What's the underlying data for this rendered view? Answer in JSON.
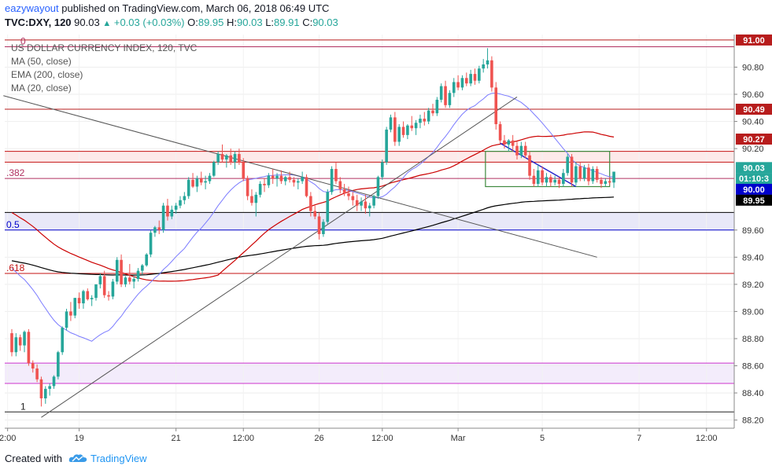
{
  "header": {
    "author": "eazywayout",
    "published_text": "published on TradingView.com, March 06, 2018 06:49 UTC",
    "symbol_interval": "TVC:DXY, 120",
    "last": "90.03",
    "change": "+0.03 (+0.03%)",
    "o_label": "O:",
    "o_value": "89.95",
    "h_label": "H:",
    "h_value": "90.03",
    "l_label": "L:",
    "l_value": "89.91",
    "c_label": "C:",
    "c_value": "90.03"
  },
  "legend": {
    "title": "US DOLLAR CURRENCY INDEX, 120, TVC",
    "items": [
      "MA (50, close)",
      "EMA (200, close)",
      "MA (20, close)"
    ]
  },
  "footer": {
    "created_with": "Created with",
    "brand": "TradingView"
  },
  "colors": {
    "up": "#26a69a",
    "down": "#ef5350",
    "ma50": "#cc0000",
    "ema200": "#000000",
    "ma20": "#7b7bff",
    "trend": "#555555",
    "fib_blue": "#0000cc",
    "fib_red": "#c41212",
    "purple": "#cc33cc",
    "box": "#3f8a3f",
    "blue_line": "#2222cc"
  },
  "chart_data": {
    "type": "candlestick",
    "y_range": [
      88.14,
      91.04
    ],
    "y_ticks": [
      "90.80",
      "90.60",
      "90.40",
      "90.20",
      "89.60",
      "89.40",
      "89.20",
      "89.00",
      "88.80",
      "88.60",
      "88.40",
      "88.20"
    ],
    "x_ticks": [
      "2:00",
      "19",
      "21",
      "12:00",
      "26",
      "12:00",
      "Mar",
      "5",
      "7",
      "12:00"
    ],
    "price_labels": [
      {
        "text": "91.00",
        "value": 91.0,
        "bg": "#b71c1c",
        "fg": "#ffffff"
      },
      {
        "text": "90.49",
        "value": 90.49,
        "bg": "#b71c1c",
        "fg": "#ffffff"
      },
      {
        "text": "90.27",
        "value": 90.27,
        "bg": "#b71c1c",
        "fg": "#ffffff"
      },
      {
        "text": "90.03",
        "value": 90.06,
        "bg": "#26a69a",
        "fg": "#ffffff"
      },
      {
        "text": "01:10:3",
        "value": 89.98,
        "bg": "#26a69a",
        "fg": "#ffffff"
      },
      {
        "text": "90.00",
        "value": 89.9,
        "bg": "#0000cc",
        "fg": "#ffffff"
      },
      {
        "text": "89.95",
        "value": 89.82,
        "bg": "#000000",
        "fg": "#ffffff"
      }
    ],
    "fib_levels": [
      {
        "label": "0",
        "value": 90.95
      },
      {
        "label": ".382",
        "value": 89.98
      },
      {
        "label": "0.5",
        "value": 89.6
      },
      {
        "label": ".618",
        "value": 89.28
      },
      {
        "label": "1",
        "value": 88.26
      }
    ],
    "horizontal_levels": [
      {
        "value": 91.0,
        "color": "#b71c1c"
      },
      {
        "value": 90.95,
        "color": "#222222"
      },
      {
        "value": 90.49,
        "color": "#b71c1c"
      },
      {
        "value": 90.18,
        "color": "#c41212"
      },
      {
        "value": 90.1,
        "color": "#c41212"
      },
      {
        "value": 89.73,
        "color": "#000000"
      },
      {
        "value": 88.62,
        "color": "#cc33cc"
      },
      {
        "value": 88.47,
        "color": "#cc33cc"
      }
    ],
    "bands": [
      {
        "from": 89.6,
        "to": 89.73,
        "color": "#e8e8f8"
      },
      {
        "from": 88.47,
        "to": 88.62,
        "color": "#f3ecfb"
      },
      {
        "from": 90.1,
        "to": 90.18,
        "color": "#fdeaea"
      }
    ],
    "trendlines": [
      {
        "from": [
          -2,
          90.59
        ],
        "to": [
          139,
          89.4
        ],
        "color": "#555555"
      },
      {
        "from": [
          7,
          88.22
        ],
        "to": [
          120,
          90.58
        ],
        "color": "#555555"
      },
      {
        "from": [
          116,
          90.24
        ],
        "to": [
          134,
          89.92
        ],
        "color": "#2222cc"
      }
    ],
    "box": {
      "i1": 112.5,
      "i2": 142,
      "top": 90.18,
      "bottom": 89.92
    },
    "candles": [
      [
        88.84,
        88.87,
        88.67,
        88.7
      ],
      [
        88.7,
        88.84,
        88.67,
        88.81
      ],
      [
        88.81,
        88.83,
        88.71,
        88.75
      ],
      [
        88.75,
        88.86,
        88.7,
        88.85
      ],
      [
        88.85,
        88.87,
        88.6,
        88.62
      ],
      [
        88.62,
        88.64,
        88.55,
        88.58
      ],
      [
        88.58,
        88.61,
        88.48,
        88.5
      ],
      [
        88.5,
        88.52,
        88.3,
        88.36
      ],
      [
        88.36,
        88.45,
        88.32,
        88.43
      ],
      [
        88.43,
        88.47,
        88.38,
        88.45
      ],
      [
        88.45,
        88.53,
        88.43,
        88.52
      ],
      [
        88.52,
        88.71,
        88.5,
        88.7
      ],
      [
        88.7,
        88.89,
        88.68,
        88.88
      ],
      [
        88.88,
        89.02,
        88.86,
        89.0
      ],
      [
        89.0,
        89.07,
        88.93,
        88.97
      ],
      [
        88.97,
        89.1,
        88.95,
        89.1
      ],
      [
        89.1,
        89.14,
        89.02,
        89.06
      ],
      [
        89.06,
        89.16,
        89.02,
        89.15
      ],
      [
        89.15,
        89.17,
        89.08,
        89.09
      ],
      [
        89.09,
        89.12,
        89.04,
        89.1
      ],
      [
        89.1,
        89.2,
        89.08,
        89.2
      ],
      [
        89.2,
        89.28,
        89.17,
        89.26
      ],
      [
        89.26,
        89.3,
        89.1,
        89.12
      ],
      [
        89.12,
        89.15,
        89.08,
        89.11
      ],
      [
        89.11,
        89.24,
        89.09,
        89.22
      ],
      [
        89.22,
        89.4,
        89.2,
        89.38
      ],
      [
        89.38,
        89.42,
        89.18,
        89.2
      ],
      [
        89.2,
        89.26,
        89.18,
        89.25
      ],
      [
        89.25,
        89.35,
        89.2,
        89.22
      ],
      [
        89.22,
        89.26,
        89.17,
        89.24
      ],
      [
        89.24,
        89.32,
        89.22,
        89.3
      ],
      [
        89.3,
        89.35,
        89.27,
        89.34
      ],
      [
        89.34,
        89.43,
        89.33,
        89.42
      ],
      [
        89.42,
        89.6,
        89.4,
        89.58
      ],
      [
        89.58,
        89.63,
        89.55,
        89.62
      ],
      [
        89.62,
        89.67,
        89.57,
        89.6
      ],
      [
        89.6,
        89.8,
        89.58,
        89.78
      ],
      [
        89.78,
        89.83,
        89.67,
        89.7
      ],
      [
        89.7,
        89.78,
        89.68,
        89.75
      ],
      [
        89.75,
        89.8,
        89.72,
        89.78
      ],
      [
        89.78,
        89.85,
        89.76,
        89.82
      ],
      [
        89.82,
        89.88,
        89.79,
        89.85
      ],
      [
        89.85,
        89.99,
        89.83,
        89.97
      ],
      [
        89.97,
        90.02,
        89.91,
        89.92
      ],
      [
        89.92,
        90.0,
        89.88,
        89.98
      ],
      [
        89.98,
        90.03,
        89.93,
        89.95
      ],
      [
        89.95,
        90.0,
        89.9,
        89.96
      ],
      [
        89.96,
        90.02,
        89.94,
        90.0
      ],
      [
        90.0,
        90.11,
        89.99,
        90.1
      ],
      [
        90.1,
        90.18,
        90.08,
        90.16
      ],
      [
        90.16,
        90.23,
        90.1,
        90.12
      ],
      [
        90.12,
        90.16,
        90.06,
        90.15
      ],
      [
        90.15,
        90.2,
        90.08,
        90.1
      ],
      [
        90.1,
        90.18,
        90.05,
        90.16
      ],
      [
        90.16,
        90.2,
        90.08,
        90.1
      ],
      [
        90.1,
        90.13,
        89.96,
        89.98
      ],
      [
        89.98,
        90.0,
        89.82,
        89.85
      ],
      [
        89.85,
        89.9,
        89.78,
        89.8
      ],
      [
        89.8,
        89.88,
        89.7,
        89.86
      ],
      [
        89.86,
        89.96,
        89.84,
        89.94
      ],
      [
        89.94,
        89.98,
        89.88,
        89.93
      ],
      [
        89.93,
        90.02,
        89.91,
        90.0
      ],
      [
        90.0,
        90.05,
        89.94,
        89.98
      ],
      [
        89.98,
        90.02,
        89.92,
        90.0
      ],
      [
        90.0,
        90.04,
        89.94,
        89.96
      ],
      [
        89.96,
        90.0,
        89.93,
        89.99
      ],
      [
        89.99,
        90.03,
        89.95,
        89.97
      ],
      [
        89.97,
        89.99,
        89.92,
        89.95
      ],
      [
        89.95,
        89.98,
        89.9,
        89.96
      ],
      [
        89.96,
        90.03,
        89.94,
        89.99
      ],
      [
        89.99,
        90.01,
        89.84,
        89.85
      ],
      [
        89.85,
        89.88,
        89.7,
        89.74
      ],
      [
        89.74,
        89.78,
        89.68,
        89.7
      ],
      [
        89.7,
        89.73,
        89.53,
        89.57
      ],
      [
        89.57,
        89.68,
        89.55,
        89.66
      ],
      [
        89.66,
        89.9,
        89.64,
        89.88
      ],
      [
        89.88,
        90.07,
        89.86,
        90.05
      ],
      [
        90.05,
        90.1,
        89.94,
        89.96
      ],
      [
        89.96,
        89.99,
        89.87,
        89.9
      ],
      [
        89.9,
        89.94,
        89.85,
        89.87
      ],
      [
        89.87,
        89.92,
        89.82,
        89.85
      ],
      [
        89.85,
        89.88,
        89.78,
        89.82
      ],
      [
        89.82,
        89.86,
        89.74,
        89.78
      ],
      [
        89.78,
        89.84,
        89.74,
        89.81
      ],
      [
        89.81,
        89.86,
        89.72,
        89.76
      ],
      [
        89.76,
        89.8,
        89.7,
        89.78
      ],
      [
        89.78,
        89.86,
        89.76,
        89.85
      ],
      [
        89.85,
        90.0,
        89.83,
        89.99
      ],
      [
        89.99,
        90.12,
        89.97,
        90.1
      ],
      [
        90.1,
        90.36,
        90.08,
        90.34
      ],
      [
        90.34,
        90.45,
        90.32,
        90.43
      ],
      [
        90.43,
        90.47,
        90.22,
        90.25
      ],
      [
        90.25,
        90.38,
        90.22,
        90.36
      ],
      [
        90.36,
        90.4,
        90.28,
        90.3
      ],
      [
        90.3,
        90.38,
        90.27,
        90.37
      ],
      [
        90.37,
        90.44,
        90.33,
        90.35
      ],
      [
        90.35,
        90.41,
        90.3,
        90.39
      ],
      [
        90.39,
        90.45,
        90.35,
        90.42
      ],
      [
        90.42,
        90.47,
        90.37,
        90.4
      ],
      [
        90.4,
        90.5,
        90.38,
        90.48
      ],
      [
        90.48,
        90.53,
        90.44,
        90.46
      ],
      [
        90.46,
        90.58,
        90.44,
        90.56
      ],
      [
        90.56,
        90.68,
        90.54,
        90.66
      ],
      [
        90.66,
        90.7,
        90.5,
        90.52
      ],
      [
        90.52,
        90.63,
        90.5,
        90.61
      ],
      [
        90.61,
        90.72,
        90.58,
        90.69
      ],
      [
        90.69,
        90.74,
        90.63,
        90.65
      ],
      [
        90.65,
        90.74,
        90.63,
        90.72
      ],
      [
        90.72,
        90.76,
        90.66,
        90.68
      ],
      [
        90.68,
        90.78,
        90.66,
        90.75
      ],
      [
        90.75,
        90.79,
        90.67,
        90.7
      ],
      [
        90.7,
        90.81,
        90.68,
        90.79
      ],
      [
        90.79,
        90.86,
        90.76,
        90.82
      ],
      [
        90.82,
        90.94,
        90.79,
        90.85
      ],
      [
        90.85,
        90.88,
        90.62,
        90.65
      ],
      [
        90.65,
        90.69,
        90.34,
        90.38
      ],
      [
        90.38,
        90.4,
        90.24,
        90.26
      ],
      [
        90.26,
        90.3,
        90.2,
        90.23
      ],
      [
        90.23,
        90.27,
        90.18,
        90.26
      ],
      [
        90.26,
        90.3,
        90.18,
        90.22
      ],
      [
        90.22,
        90.25,
        90.12,
        90.15
      ],
      [
        90.15,
        90.25,
        90.13,
        90.22
      ],
      [
        90.22,
        90.25,
        90.13,
        90.15
      ],
      [
        90.15,
        90.18,
        89.97,
        90.0
      ],
      [
        90.0,
        90.05,
        89.92,
        89.94
      ],
      [
        89.94,
        90.08,
        89.92,
        90.04
      ],
      [
        90.04,
        90.07,
        89.93,
        89.95
      ],
      [
        89.95,
        90.02,
        89.92,
        89.99
      ],
      [
        89.99,
        90.01,
        89.92,
        89.95
      ],
      [
        89.95,
        90.0,
        89.93,
        89.97
      ],
      [
        89.97,
        89.99,
        89.91,
        89.94
      ],
      [
        89.94,
        90.05,
        89.92,
        90.02
      ],
      [
        90.02,
        90.16,
        90.0,
        90.14
      ],
      [
        90.14,
        90.16,
        89.92,
        89.95
      ],
      [
        89.95,
        90.1,
        89.93,
        90.07
      ],
      [
        90.07,
        90.1,
        89.96,
        89.98
      ],
      [
        89.98,
        90.08,
        89.96,
        90.06
      ],
      [
        90.06,
        90.09,
        89.93,
        89.96
      ],
      [
        89.96,
        90.07,
        89.94,
        90.05
      ],
      [
        90.05,
        90.07,
        89.95,
        89.97
      ],
      [
        89.97,
        89.99,
        89.91,
        89.94
      ],
      [
        89.94,
        89.98,
        89.92,
        89.96
      ],
      [
        89.96,
        89.99,
        89.93,
        89.95
      ],
      [
        89.95,
        90.03,
        89.91,
        90.03
      ]
    ]
  }
}
